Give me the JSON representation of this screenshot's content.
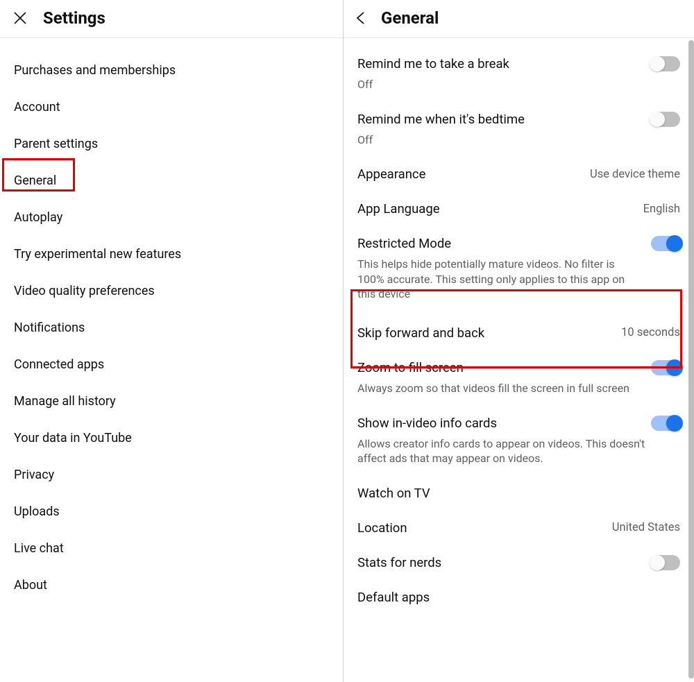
{
  "left": {
    "title": "Settings",
    "items": [
      "Purchases and memberships",
      "Account",
      "Parent settings",
      "General",
      "Autoplay",
      "Try experimental new features",
      "Video quality preferences",
      "Notifications",
      "Connected apps",
      "Manage all history",
      "Your data in YouTube",
      "Privacy",
      "Uploads",
      "Live chat",
      "About"
    ]
  },
  "right": {
    "title": "General",
    "options": {
      "remind_break": {
        "title": "Remind me to take a break",
        "state": "Off"
      },
      "remind_bedtime": {
        "title": "Remind me when it's bedtime",
        "state": "Off"
      },
      "appearance": {
        "title": "Appearance",
        "value": "Use device theme"
      },
      "app_language": {
        "title": "App Language",
        "value": "English"
      },
      "restricted": {
        "title": "Restricted Mode",
        "desc": "This helps hide potentially mature videos. No filter is 100% accurate. This setting only applies to this app on this device"
      },
      "skip": {
        "title": "Skip forward and back",
        "value": "10 seconds"
      },
      "zoom": {
        "title": "Zoom to fill screen",
        "desc": "Always zoom so that videos fill the screen in full screen"
      },
      "info_cards": {
        "title": "Show in-video info cards",
        "desc": "Allows creator info cards to appear on videos. This doesn't affect ads that may appear on videos."
      },
      "watch_tv": {
        "title": "Watch on TV"
      },
      "location": {
        "title": "Location",
        "value": "United States"
      },
      "stats": {
        "title": "Stats for nerds"
      },
      "default_apps": {
        "title": "Default apps"
      }
    }
  }
}
